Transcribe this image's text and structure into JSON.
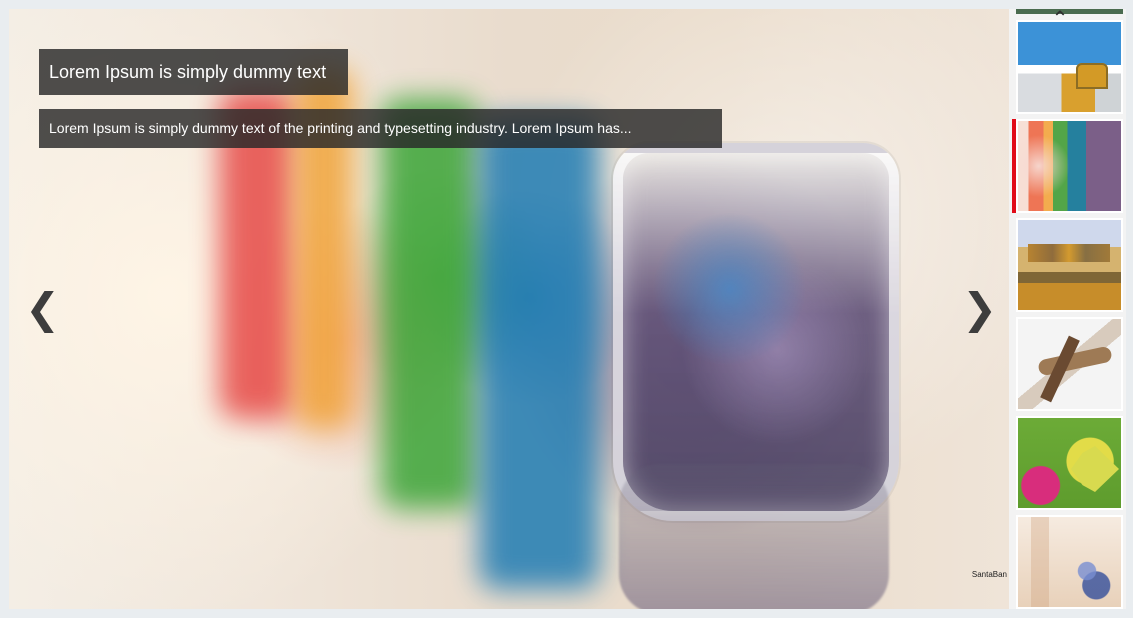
{
  "slider": {
    "title": "Lorem Ipsum is simply dummy text",
    "description": "Lorem Ipsum is simply dummy text of the printing and typesetting industry. Lorem Ipsum has...",
    "credit": "SantaBan",
    "prev_arrow": "❮",
    "next_arrow": "❯"
  },
  "sidebar": {
    "up_arrow": "⌃",
    "fullscreen_icon": "⤢",
    "active_index": 2
  },
  "thumbnails": [
    {
      "name": "temple-thumbnail"
    },
    {
      "name": "glasses-thumbnail"
    },
    {
      "name": "sunset-temple-thumbnail"
    },
    {
      "name": "wooden-plane-thumbnail"
    },
    {
      "name": "butterfly-thumbnail"
    },
    {
      "name": "cards-thumbnail"
    }
  ],
  "colors": {
    "active_indicator": "#e10b18",
    "caption_background": "#282828",
    "arrow": "#3d3d3d"
  }
}
